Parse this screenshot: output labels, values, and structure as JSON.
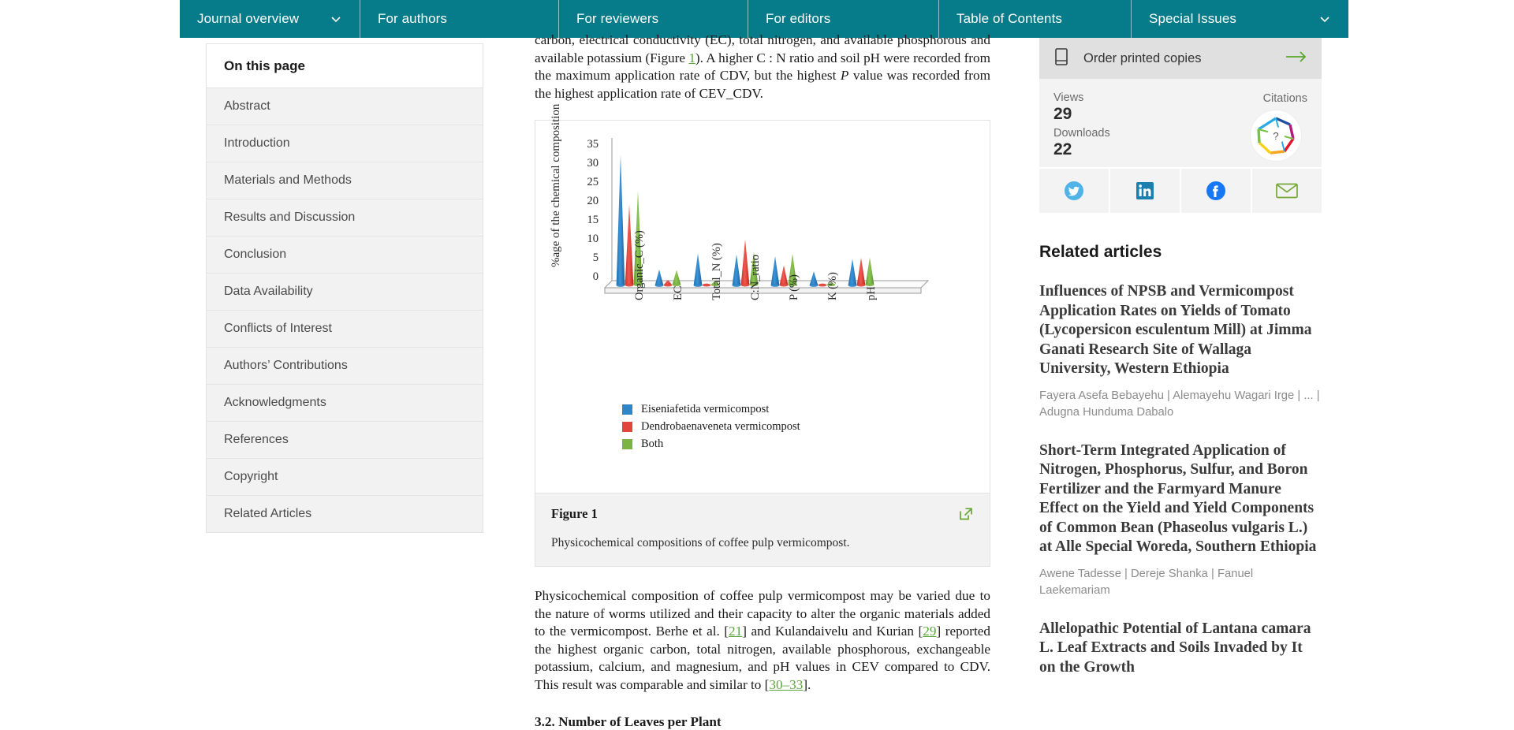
{
  "nav": {
    "items": [
      {
        "label": "Journal overview",
        "caret": true,
        "icon": "chevron-down-icon"
      },
      {
        "label": "For authors",
        "caret": false,
        "icon": ""
      },
      {
        "label": "For reviewers",
        "caret": false,
        "icon": ""
      },
      {
        "label": "For editors",
        "caret": false,
        "icon": ""
      },
      {
        "label": "Table of Contents",
        "caret": false,
        "icon": ""
      },
      {
        "label": "Special Issues",
        "caret": true,
        "icon": "chevron-down-icon"
      }
    ],
    "background": "#067c8a"
  },
  "toc": {
    "title": "On this page",
    "items": [
      "Abstract",
      "Introduction",
      "Materials and Methods",
      "Results and Discussion",
      "Conclusion",
      "Data Availability",
      "Conflicts of Interest",
      "Authors’ Contributions",
      "Acknowledgments",
      "References",
      "Copyright",
      "Related Articles"
    ]
  },
  "article": {
    "para_top_a": "carbon, electrical conductivity (EC), total nitrogen, and available phosphorous and",
    "para_top_b_1": "available potassium (Figure ",
    "para_top_b_ref": "1",
    "para_top_b_2": "). A higher C : N ratio and soil pH were recorded from the maximum application rate of CDV, but the highest ",
    "para_top_b_em": "P",
    "para_top_b_3": " value was recorded from the highest application rate of CEV_CDV.",
    "figure": {
      "title": "Figure 1",
      "caption": "Physicochemical compositions of coffee pulp vermicompost.",
      "expand_icon": "external-link-icon"
    },
    "para_bottom_1": "Physicochemical composition of coffee pulp vermicompost may be varied due to the nature of worms utilized and their capacity to alter the organic materials added to the vermicompost. Berhe et al. [",
    "para_bottom_r1": "21",
    "para_bottom_2": "] and Kulandaivelu and Kurian [",
    "para_bottom_r2": "29",
    "para_bottom_3": "] reported the highest organic carbon, total nitrogen, available phosphorous, exchangeable potassium, calcium, and magnesium, and pH values in CEV compared to CDV. This result was comparable and similar to [",
    "para_bottom_r3": "30–33",
    "para_bottom_4": "].",
    "section_heading": "3.2. Number of Leaves per Plant"
  },
  "chart_data": {
    "type": "bar",
    "title": "",
    "xlabel": "",
    "ylabel": "%age of the chemical composition",
    "ylim": [
      0,
      35
    ],
    "yticks": [
      35,
      30,
      25,
      20,
      15,
      10,
      5,
      0
    ],
    "grid": false,
    "legend_position": "bottom-left",
    "categories": [
      "Organic_C (%)",
      "EC",
      "Total_N (%)",
      "C:N_ratio",
      "P (%)",
      "K (%)",
      "pH"
    ],
    "series": [
      {
        "name": "Eiseniafetida vermicompost",
        "color": "#2e86c8",
        "values": [
          34.5,
          4.2,
          8.4,
          8.2,
          7.7,
          3.7,
          7.0
        ]
      },
      {
        "name": "Dendrobaenaveneta vermicompost",
        "color": "#e2453c",
        "values": [
          21.3,
          1.4,
          0.4,
          12.1,
          5.2,
          0.3,
          7.2
        ]
      },
      {
        "name": "Both",
        "color": "#7bb443",
        "values": [
          24.8,
          3.9,
          1.1,
          8.8,
          8.2,
          0.5,
          7.2
        ]
      }
    ]
  },
  "rail": {
    "order": {
      "label": "Order printed copies",
      "icon": "book-icon",
      "arrow_icon": "arrow-right-icon"
    },
    "metrics": {
      "views_label": "Views",
      "views_value": "29",
      "downloads_label": "Downloads",
      "downloads_value": "22",
      "citations_label": "Citations",
      "citations_badge": "?"
    },
    "share": [
      {
        "name": "twitter-icon",
        "color": "#4fb3e8"
      },
      {
        "name": "linkedin-icon",
        "color": "#1b80b0"
      },
      {
        "name": "facebook-icon",
        "color": "#1877f2"
      },
      {
        "name": "email-icon",
        "color": "#76a835"
      }
    ],
    "related_title": "Related articles",
    "related": [
      {
        "title": "Influences of NPSB and Vermicompost Application Rates on Yields of Tomato (Lycopersicon esculentum Mill) at Jimma Ganati Research Site of Wallaga University, Western Ethiopia",
        "authors": "Fayera Asefa Bebayehu | Alemayehu Wagari Irge | ... | Adugna Hunduma Dabalo"
      },
      {
        "title": "Short-Term Integrated Application of Nitrogen, Phosphorus, Sulfur, and Boron Fertilizer and the Farmyard Manure Effect on the Yield and Yield Components of Common Bean (Phaseolus vulgaris L.) at Alle Special Woreda, Southern Ethiopia",
        "authors": "Awene Tadesse | Dereje Shanka | Fanuel Laekemariam"
      },
      {
        "title": "Allelopathic Potential of Lantana camara L. Leaf Extracts and Soils Invaded by It on the Growth",
        "authors": ""
      }
    ]
  },
  "colors": {
    "teal": "#067c8a",
    "green_link": "#5ba53b",
    "toc_bg": "#f2f2f2"
  }
}
